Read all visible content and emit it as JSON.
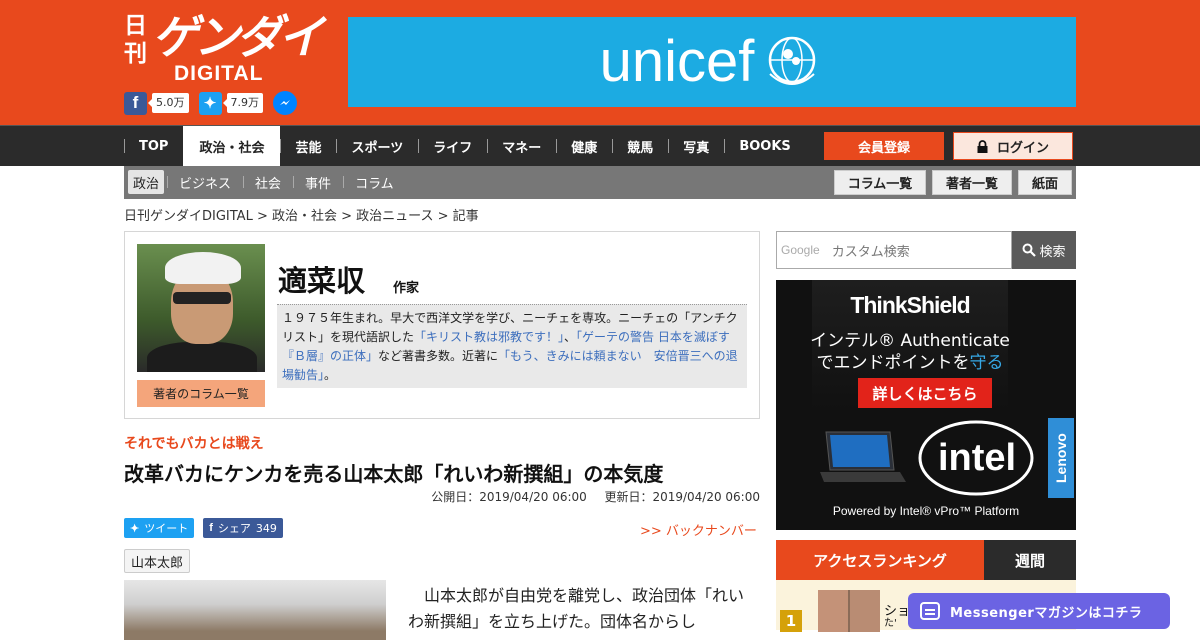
{
  "site": {
    "logo_kanji": "日刊",
    "logo_main": "ゲンダイ",
    "logo_sub": "DIGITAL",
    "facebook_count": "5.0万",
    "twitter_count": "7.9万",
    "brand_color": "#e8491d"
  },
  "ad_top": {
    "text": "unicef",
    "bg_color": "#1cabe2"
  },
  "nav": {
    "items": [
      "TOP",
      "政治・社会",
      "芸能",
      "スポーツ",
      "ライフ",
      "マネー",
      "健康",
      "競馬",
      "写真",
      "BOOKS"
    ],
    "active": "政治・社会",
    "register": "会員登録",
    "login": "ログイン"
  },
  "subnav": {
    "items": [
      "政治",
      "ビジネス",
      "社会",
      "事件",
      "コラム"
    ],
    "active": "政治",
    "buttons": [
      "コラム一覧",
      "著者一覧",
      "紙面"
    ]
  },
  "breadcrumb": "日刊ゲンダイDIGITAL > 政治・社会 > 政治ニュース > 記事",
  "author": {
    "name": "適菜収",
    "role": "作家",
    "column_list": "著者のコラム一覧",
    "bio_1": "１９７５年生まれ。早大で西洋文学を学び、ニーチェを専攻。ニーチェの「アンチクリスト」を現代語訳した",
    "bio_link_1": "「キリスト教は邪教です！」",
    "bio_2": "、",
    "bio_link_2": "「ゲーテの警告 日本を滅ぼす『Ｂ層』の正体」",
    "bio_3": "など著書多数。近著に",
    "bio_link_3": "「もう、きみには頼まない　安倍晋三への退場勧告」",
    "bio_4": "。"
  },
  "article": {
    "kicker": "それでもバカとは戦え",
    "title": "改革バカにケンカを売る山本太郎「れいわ新撰組」の本気度",
    "published": "公開日：2019/04/20 06:00",
    "updated": "更新日：2019/04/20 06:00",
    "tweet": "ツイート",
    "share": "シェア",
    "share_count": "349",
    "backnumber": ">> バックナンバー",
    "tag": "山本太郎",
    "body": "山本太郎が自由党を離党し、政治団体「れいわ新撰組」を立ち上げた。団体名からし"
  },
  "sidebar": {
    "search_brand": "Google",
    "search_placeholder": "カスタム検索",
    "search_button": "検索",
    "ad": {
      "brand": "ThinkShield",
      "line1": "インテル® Authenticate",
      "line2_pre": "でエンドポイントを",
      "line2_hl": "守る",
      "cta": "詳しくはこちら",
      "intel": "intel",
      "lenovo": "Lenovo",
      "powered": "Powered by Intel® vPro™ Platform"
    },
    "ranking_title": "アクセスランキング",
    "ranking_tab": "週間",
    "rank_1_num": "1",
    "rank_1_text": "ショ",
    "rank_1_text2": "た'"
  },
  "messenger": {
    "label": "Messengerマガジンはコチラ",
    "color": "#6b63e3"
  }
}
